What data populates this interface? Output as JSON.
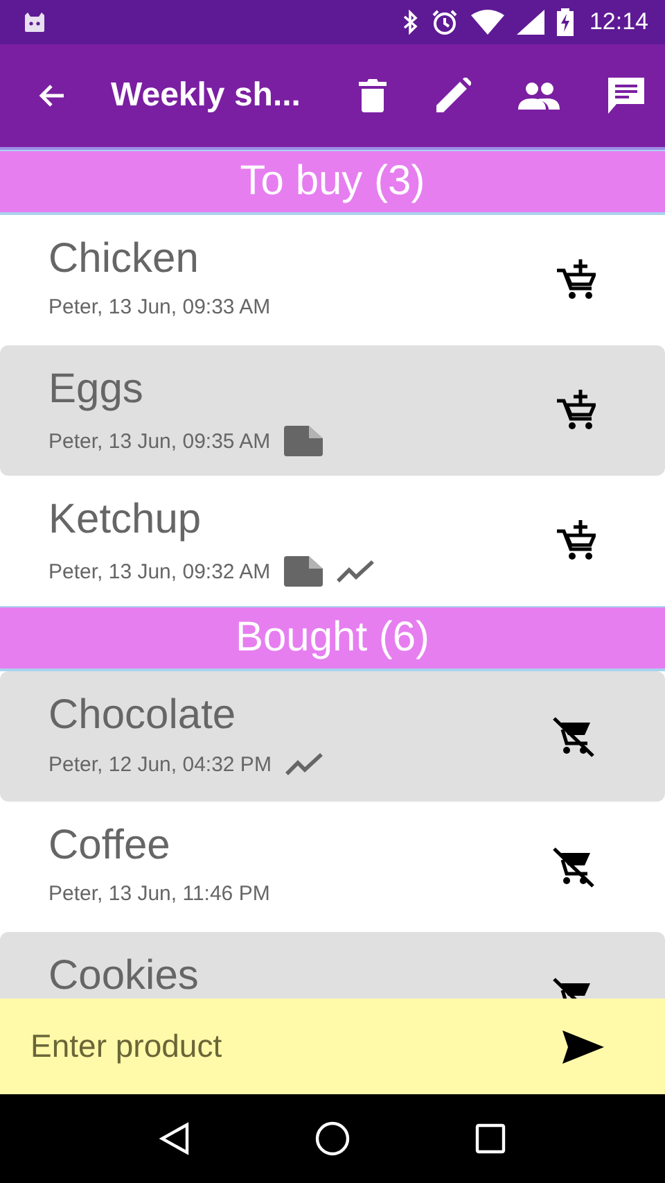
{
  "status_bar": {
    "time": "12:14"
  },
  "toolbar": {
    "title": "Weekly sh..."
  },
  "sections": [
    {
      "kind": "to_buy",
      "title": "To buy (3)",
      "items": [
        {
          "name": "Chicken",
          "meta": "Peter, 13 Jun, 09:33 AM",
          "has_note": false,
          "has_history": false
        },
        {
          "name": "Eggs",
          "meta": "Peter, 13 Jun, 09:35 AM",
          "has_note": true,
          "has_history": false
        },
        {
          "name": "Ketchup",
          "meta": "Peter, 13 Jun, 09:32 AM",
          "has_note": true,
          "has_history": true
        }
      ]
    },
    {
      "kind": "bought",
      "title": "Bought (6)",
      "items": [
        {
          "name": "Chocolate",
          "meta": "Peter, 12 Jun, 04:32 PM",
          "has_note": false,
          "has_history": true
        },
        {
          "name": "Coffee",
          "meta": "Peter, 13 Jun, 11:46 PM",
          "has_note": false,
          "has_history": false
        },
        {
          "name": "Cookies"
        }
      ]
    }
  ],
  "input": {
    "placeholder": "Enter product"
  }
}
